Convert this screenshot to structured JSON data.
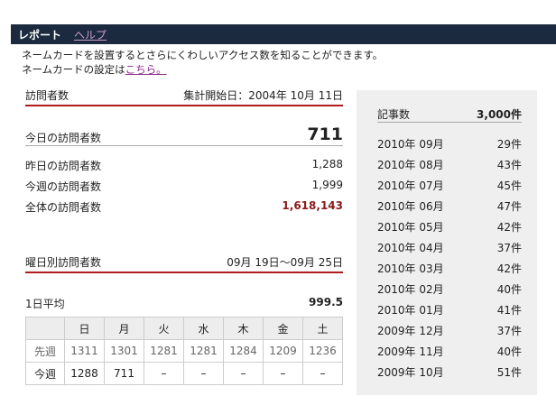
{
  "header": {
    "title": "レポート",
    "help_link": "ヘルプ"
  },
  "intro": {
    "line1": "ネームカードを設置するとさらにくわしいアクセス数を知ることができます。",
    "line2_prefix": "ネームカードの設定は",
    "line2_link": "こちら。"
  },
  "visitors": {
    "heading": "訪問者数",
    "start_date": "集計開始日：2004年 10月 11日",
    "today_label": "今日の訪問者数",
    "today_value": "711",
    "yesterday_label": "昨日の訪問者数",
    "yesterday_value": "1,288",
    "week_label": "今週の訪問者数",
    "week_value": "1,999",
    "total_label": "全体の訪問者数",
    "total_value": "1,618,143"
  },
  "weekday": {
    "heading": "曜日別訪問者数",
    "range": "09月 19日〜09月 25日",
    "avg_label": "1日平均",
    "avg_value": "999.5",
    "days": [
      "日",
      "月",
      "火",
      "水",
      "木",
      "金",
      "土"
    ],
    "rows": [
      {
        "label": "先週",
        "values": [
          "1311",
          "1301",
          "1281",
          "1281",
          "1284",
          "1209",
          "1236"
        ]
      },
      {
        "label": "今週",
        "values": [
          "1288",
          "711",
          "–",
          "–",
          "–",
          "–",
          "–"
        ]
      }
    ]
  },
  "articles": {
    "label": "記事数",
    "total": "3,000件",
    "months": [
      {
        "month": "2010年 09月",
        "count": "29件"
      },
      {
        "month": "2010年 08月",
        "count": "43件"
      },
      {
        "month": "2010年 07月",
        "count": "45件"
      },
      {
        "month": "2010年 06月",
        "count": "47件"
      },
      {
        "month": "2010年 05月",
        "count": "42件"
      },
      {
        "month": "2010年 04月",
        "count": "37件"
      },
      {
        "month": "2010年 03月",
        "count": "42件"
      },
      {
        "month": "2010年 02月",
        "count": "40件"
      },
      {
        "month": "2010年 01月",
        "count": "41件"
      },
      {
        "month": "2009年 12月",
        "count": "37件"
      },
      {
        "month": "2009年 11月",
        "count": "40件"
      },
      {
        "month": "2009年 10月",
        "count": "51件"
      }
    ]
  }
}
